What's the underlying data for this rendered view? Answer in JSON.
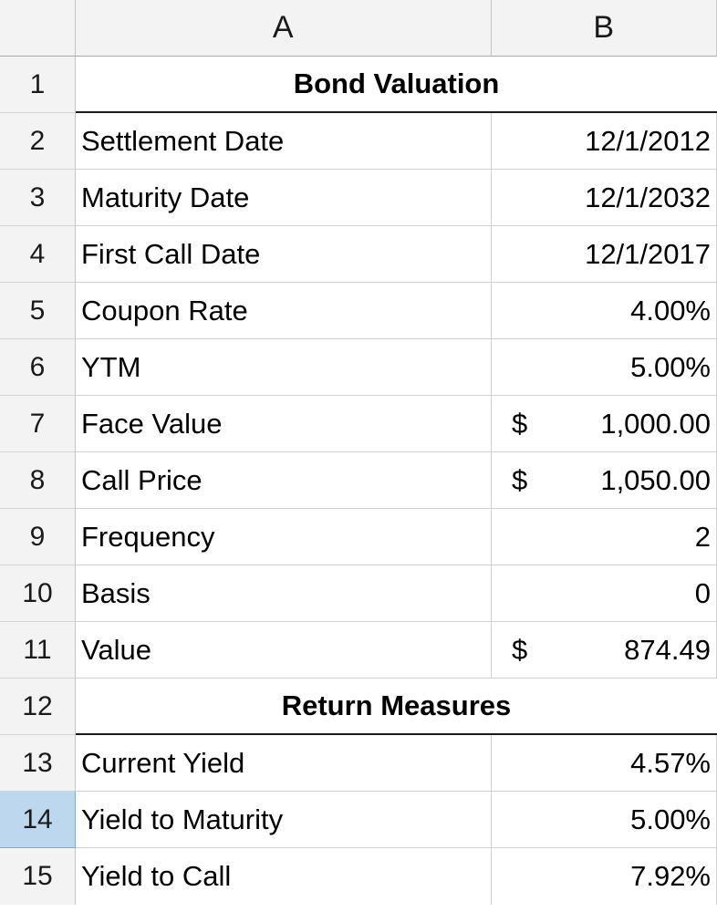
{
  "spreadsheet": {
    "column_headers": [
      "A",
      "B"
    ],
    "selected_row": "14",
    "selection_color": "#bdd7ee",
    "gridline_color": "#d0d0d0",
    "header_background": "#f3f3f3",
    "rows": [
      {
        "num": "1",
        "type": "section",
        "title": "Bond Valuation"
      },
      {
        "num": "2",
        "type": "data",
        "label": "Settlement Date",
        "value": "12/1/2012"
      },
      {
        "num": "3",
        "type": "data",
        "label": "Maturity Date",
        "value": "12/1/2032"
      },
      {
        "num": "4",
        "type": "data",
        "label": "First Call Date",
        "value": "12/1/2017"
      },
      {
        "num": "5",
        "type": "data",
        "label": "Coupon Rate",
        "value": "4.00%"
      },
      {
        "num": "6",
        "type": "data",
        "label": "YTM",
        "value": "5.00%"
      },
      {
        "num": "7",
        "type": "accounting",
        "label": "Face Value",
        "currency": "$",
        "amount": "1,000.00"
      },
      {
        "num": "8",
        "type": "accounting",
        "label": "Call Price",
        "currency": "$",
        "amount": "1,050.00"
      },
      {
        "num": "9",
        "type": "data",
        "label": "Frequency",
        "value": "2"
      },
      {
        "num": "10",
        "type": "data",
        "label": "Basis",
        "value": "0"
      },
      {
        "num": "11",
        "type": "accounting",
        "label": "Value",
        "currency": "$",
        "amount": "874.49"
      },
      {
        "num": "12",
        "type": "section",
        "title": "Return Measures"
      },
      {
        "num": "13",
        "type": "data",
        "label": "Current Yield",
        "value": "4.57%"
      },
      {
        "num": "14",
        "type": "data",
        "label": "Yield to Maturity",
        "value": "5.00%"
      },
      {
        "num": "15",
        "type": "data",
        "label": "Yield to Call",
        "value": "7.92%"
      }
    ]
  }
}
